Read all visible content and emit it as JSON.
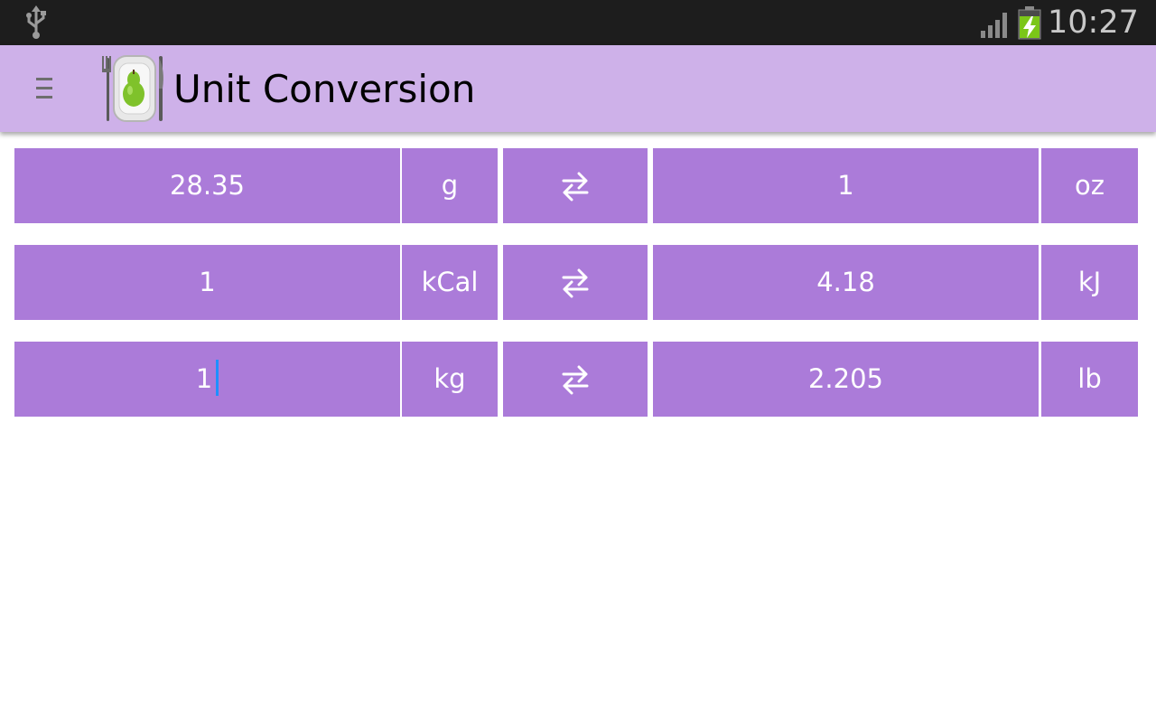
{
  "status_bar": {
    "time": "10:27",
    "icons": [
      "usb-icon",
      "signal-icon",
      "battery-charging-icon"
    ]
  },
  "action_bar": {
    "title": "Unit Conversion",
    "menu_icon": "hamburger-menu-icon",
    "logo_icon": "plate-pear-cutlery-logo"
  },
  "colors": {
    "status_bar_bg": "#1d1d1d",
    "action_bar_bg": "#ceb1e9",
    "cell_bg": "#ab7bd9",
    "cell_text": "#ffffff",
    "cursor": "#1e90ff"
  },
  "conversions": [
    {
      "left_value": "28.35",
      "left_unit": "g",
      "swap_icon": "swap-arrows-icon",
      "right_value": "1",
      "right_unit": "oz"
    },
    {
      "left_value": "1",
      "left_unit": "kCal",
      "swap_icon": "swap-arrows-icon",
      "right_value": "4.18",
      "right_unit": "kJ"
    },
    {
      "left_value": "1",
      "left_unit": "kg",
      "swap_icon": "swap-arrows-icon",
      "right_value": "2.205",
      "right_unit": "lb",
      "left_focused": true
    }
  ]
}
